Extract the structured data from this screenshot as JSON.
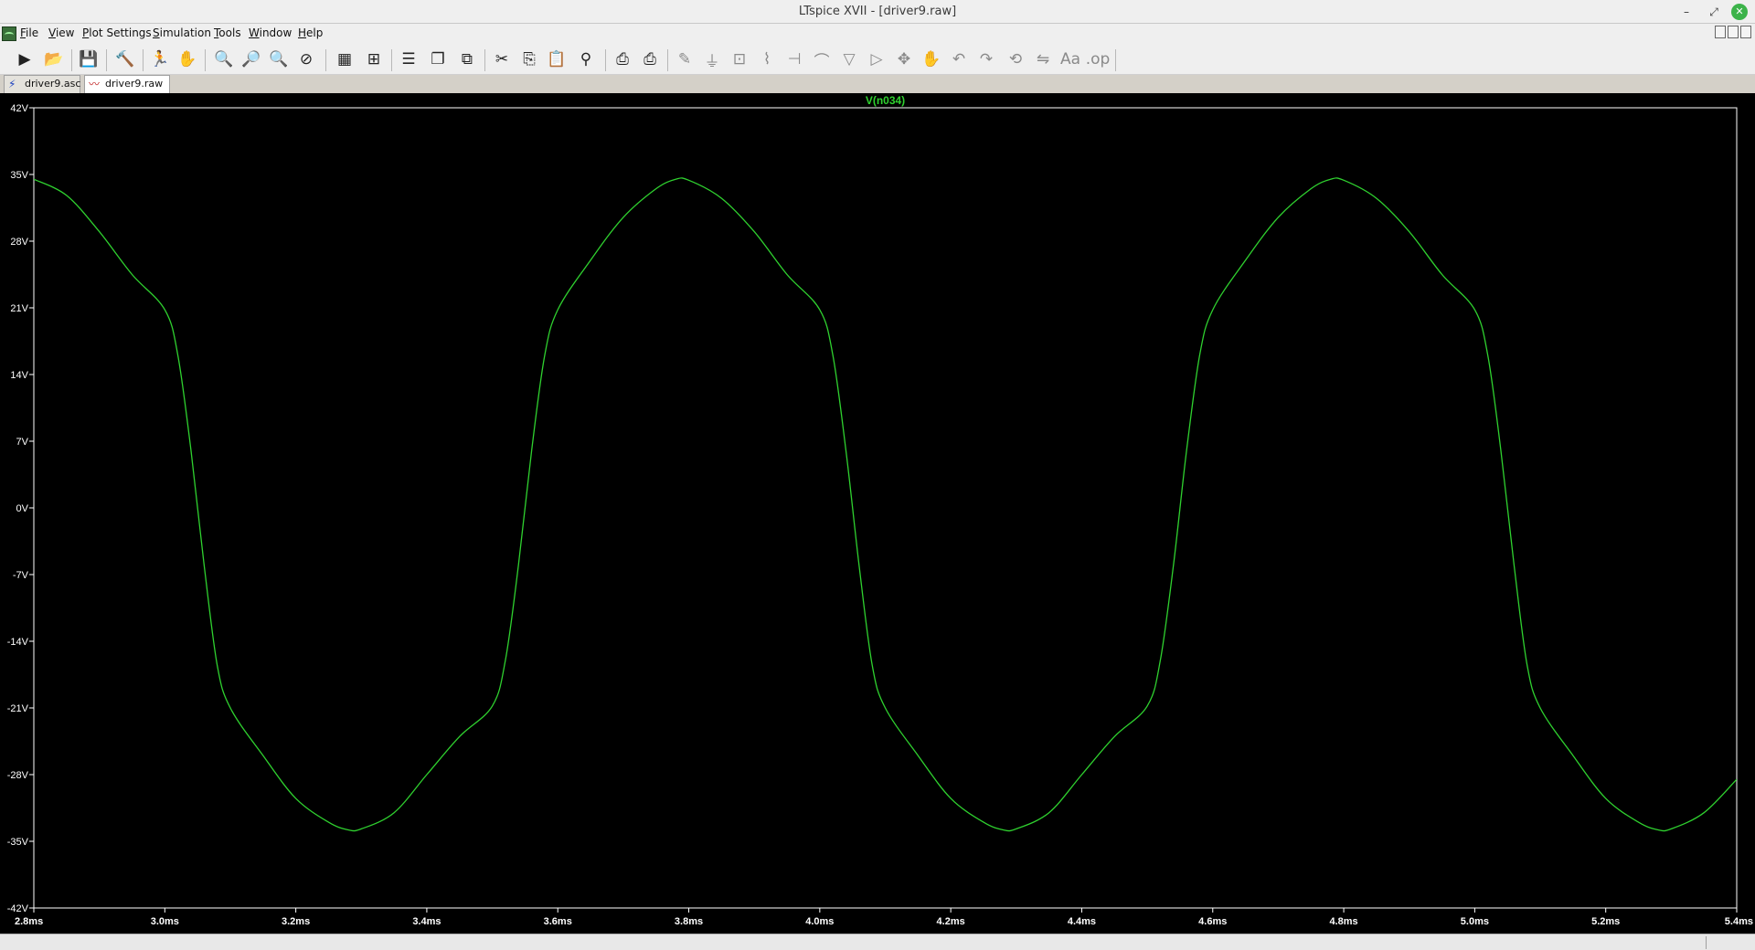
{
  "window": {
    "title": "LTspice XVII - [driver9.raw]"
  },
  "menu": [
    "File",
    "View",
    "Plot Settings",
    "Simulation",
    "Tools",
    "Window",
    "Help"
  ],
  "menu_underline": [
    "F",
    "V",
    "P",
    "S",
    "T",
    "W",
    "H"
  ],
  "tabs": [
    {
      "label": "driver9.asc",
      "icon": "schematic-icon"
    },
    {
      "label": "driver9.raw",
      "icon": "waveform-icon",
      "active": true
    }
  ],
  "colors": {
    "trace": "#2fd12f",
    "plot_bg": "#000000",
    "axis": "#ffffff"
  },
  "chart_data": {
    "type": "line",
    "title": "",
    "series": [
      {
        "name": "V(n034)",
        "color": "#2fd12f",
        "x": [
          2.8,
          2.85,
          2.9,
          2.95,
          3.0,
          3.02,
          3.04,
          3.06,
          3.08,
          3.1,
          3.15,
          3.2,
          3.25,
          3.28,
          3.3,
          3.35,
          3.4,
          3.45,
          3.5,
          3.52,
          3.54,
          3.56,
          3.58,
          3.6,
          3.65,
          3.7,
          3.75,
          3.78,
          3.8,
          3.85,
          3.9,
          3.95,
          4.0,
          4.02,
          4.04,
          4.06,
          4.08,
          4.1,
          4.15,
          4.2,
          4.25,
          4.28,
          4.3,
          4.35,
          4.4,
          4.45,
          4.5,
          4.52,
          4.54,
          4.56,
          4.58,
          4.6,
          4.65,
          4.7,
          4.75,
          4.78,
          4.8,
          4.85,
          4.9,
          4.95,
          5.0,
          5.02,
          5.04,
          5.06,
          5.08,
          5.1,
          5.15,
          5.2,
          5.25,
          5.28,
          5.3,
          5.35,
          5.4
        ],
        "y": [
          34.5,
          32.8,
          29.0,
          24.5,
          20.8,
          16.0,
          6.0,
          -6.0,
          -16.5,
          -21.0,
          -26.0,
          -30.5,
          -33.0,
          -33.8,
          -33.7,
          -32.0,
          -28.0,
          -24.0,
          -20.8,
          -16.0,
          -6.0,
          6.0,
          16.0,
          20.8,
          26.0,
          30.5,
          33.5,
          34.5,
          34.4,
          32.5,
          29.0,
          24.5,
          20.8,
          16.0,
          6.0,
          -6.0,
          -16.5,
          -21.0,
          -26.0,
          -30.5,
          -33.0,
          -33.8,
          -33.7,
          -32.0,
          -28.0,
          -24.0,
          -20.8,
          -16.0,
          -6.0,
          6.0,
          16.0,
          20.8,
          26.0,
          30.5,
          33.5,
          34.5,
          34.4,
          32.5,
          29.0,
          24.5,
          20.8,
          16.0,
          6.0,
          -6.0,
          -16.5,
          -21.0,
          -26.0,
          -30.5,
          -33.0,
          -33.8,
          -33.7,
          -32.0,
          -28.5
        ]
      }
    ],
    "xlim": [
      2.8,
      5.4
    ],
    "ylim": [
      -42,
      42
    ],
    "x_ticks": [
      2.8,
      3.0,
      3.2,
      3.4,
      3.6,
      3.8,
      4.0,
      4.2,
      4.4,
      4.6,
      4.8,
      5.0,
      5.2,
      5.4
    ],
    "x_tick_labels": [
      "2.8ms",
      "3.0ms",
      "3.2ms",
      "3.4ms",
      "3.6ms",
      "3.8ms",
      "4.0ms",
      "4.2ms",
      "4.4ms",
      "4.6ms",
      "4.8ms",
      "5.0ms",
      "5.2ms",
      "5.4ms"
    ],
    "y_ticks": [
      42,
      35,
      28,
      21,
      14,
      7,
      0,
      -7,
      -14,
      -21,
      -28,
      -35,
      -42
    ],
    "y_tick_labels": [
      "42V",
      "35V",
      "28V",
      "21V",
      "14V",
      "7V",
      "0V",
      "-7V",
      "-14V",
      "-21V",
      "-28V",
      "-35V",
      "-42V"
    ],
    "grid": false,
    "legend": "top-center"
  }
}
